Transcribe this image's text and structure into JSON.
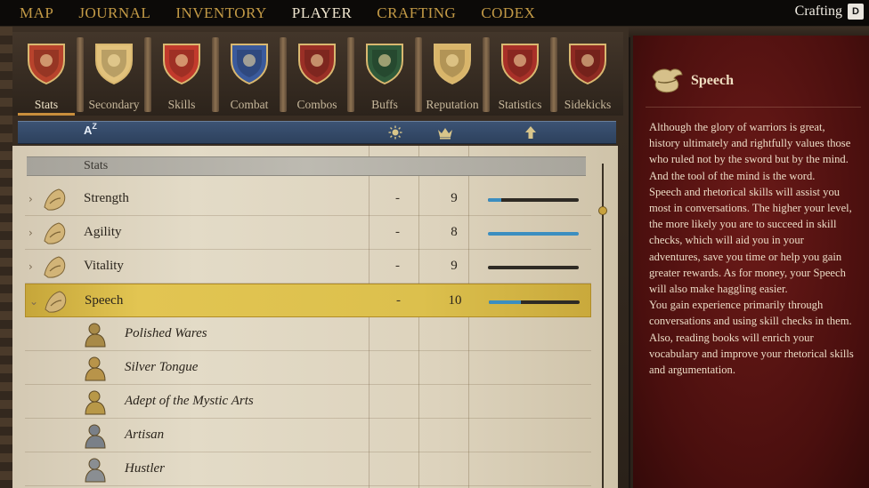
{
  "topnav": {
    "items": [
      "MAP",
      "JOURNAL",
      "INVENTORY",
      "PLAYER",
      "CRAFTING",
      "CODEX"
    ],
    "active_index": 3,
    "right_label": "Crafting",
    "right_key": "D"
  },
  "tabs": [
    {
      "label": "Stats",
      "icon": "lion-shield-icon"
    },
    {
      "label": "Secondary",
      "icon": "cross-shield-icon"
    },
    {
      "label": "Skills",
      "icon": "griffin-shield-icon"
    },
    {
      "label": "Combat",
      "icon": "crossed-swords-shield-icon"
    },
    {
      "label": "Combos",
      "icon": "slingshot-shield-icon"
    },
    {
      "label": "Buffs",
      "icon": "fist-shield-icon"
    },
    {
      "label": "Reputation",
      "icon": "banner-shield-icon"
    },
    {
      "label": "Statistics",
      "icon": "target-shield-icon"
    },
    {
      "label": "Sidekicks",
      "icon": "dog-shield-icon"
    }
  ],
  "active_tab": 0,
  "table_header": {
    "sort_label": "A",
    "sort_sub": "Z",
    "col_icons": [
      "sun-icon",
      "crown-icon",
      "up-arrow-icon"
    ]
  },
  "section": {
    "label": "Stats"
  },
  "stats": [
    {
      "name": "Strength",
      "buff": "-",
      "level": "9",
      "progress": 0.15,
      "icon": "strength-arm-icon"
    },
    {
      "name": "Agility",
      "buff": "-",
      "level": "8",
      "progress": 1.0,
      "icon": "agility-feather-icon"
    },
    {
      "name": "Vitality",
      "buff": "-",
      "level": "9",
      "progress": 0.0,
      "icon": "vitality-heart-icon"
    },
    {
      "name": "Speech",
      "buff": "-",
      "level": "10",
      "progress": 0.35,
      "icon": "speech-lips-icon",
      "selected": true
    }
  ],
  "perks": [
    {
      "name": "Polished Wares",
      "icon": "merchant-icon"
    },
    {
      "name": "Silver Tongue",
      "icon": "head-icon"
    },
    {
      "name": "Adept of the Mystic Arts",
      "icon": "mystic-icon"
    },
    {
      "name": "Artisan",
      "icon": "artisan-icon"
    },
    {
      "name": "Hustler",
      "icon": "hustler-icon"
    }
  ],
  "detail": {
    "title": "Speech",
    "icon": "speech-lips-icon",
    "paragraphs": [
      "Although the glory of warriors is great, history ultimately and rightfully values those who ruled not by the sword but by the mind. And the tool of the mind is the word.",
      "Speech and rhetorical skills will assist you most in conversations. The higher your level, the more likely you are to succeed in skill checks, which will aid you in your adventures, save you time or help you gain greater rewards. As for money, your Speech will also make haggling easier.",
      "You gain experience primarily through conversations and using skill checks in them. Also, reading books will enrich your vocabulary and improve your rhetorical skills and argumentation."
    ]
  },
  "colors": {
    "nav_gold": "#c39a46",
    "selected_row": "#e2c552",
    "progress_blue": "#3b8ec0",
    "detail_red": "#5e1514"
  }
}
